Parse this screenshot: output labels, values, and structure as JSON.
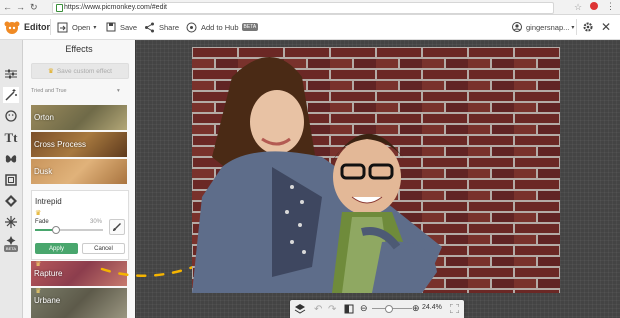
{
  "browser": {
    "url": "https://www.picmonkey.com/#edit",
    "nav_back": "←",
    "nav_forward": "→",
    "nav_reload": "↻"
  },
  "toolbar": {
    "app_name": "Editor",
    "open_label": "Open",
    "save_label": "Save",
    "share_label": "Share",
    "hub_label": "Add to Hub",
    "beta_badge": "BETA",
    "username": "gingersnap..."
  },
  "panel": {
    "title": "Effects",
    "save_custom": "Save custom effect",
    "category": "Tried and True",
    "effects_above": [
      {
        "label": "Orton"
      },
      {
        "label": "Cross Process"
      },
      {
        "label": "Dusk"
      }
    ],
    "active_effect": {
      "name": "Intrepid",
      "fade_label": "Fade",
      "fade_value": "30%",
      "fade_fraction": 0.3,
      "apply_label": "Apply",
      "cancel_label": "Cancel"
    },
    "effects_below": [
      {
        "label": "Rapture"
      },
      {
        "label": "Urbane"
      }
    ]
  },
  "rail": {
    "beta_badge": "BETA"
  },
  "bottombar": {
    "zoom_level": "24.4%"
  },
  "colors": {
    "accent_green": "#49a66d",
    "brand_orange": "#f08a24",
    "canvas_bg": "#444444"
  }
}
